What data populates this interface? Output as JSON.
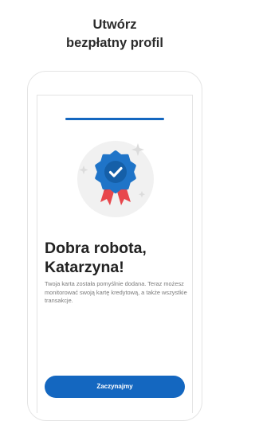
{
  "header": {
    "line1": "Utwórz",
    "line2": "bezpłatny profil"
  },
  "progress": {
    "value": 1.0,
    "color": "#1467c0"
  },
  "badge": {
    "icon": "verified-ribbon-icon",
    "seal_color": "#1f74c8",
    "ribbon_color": "#e8474c"
  },
  "content": {
    "title_line1": "Dobra robota,",
    "title_line2": "Katarzyna!",
    "body": "Twoja karta została pomyślnie dodana. Teraz możesz monitorować swoją kartę kredytową, a także wszystkie transakcje."
  },
  "cta": {
    "label": "Zaczynajmy",
    "color": "#1467c0"
  }
}
